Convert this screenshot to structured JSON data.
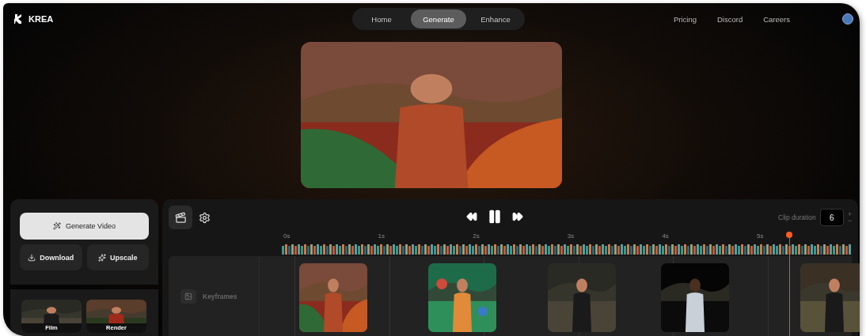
{
  "brand": "KREA",
  "nav_tabs": [
    {
      "label": "Home",
      "selected": false
    },
    {
      "label": "Generate",
      "selected": true
    },
    {
      "label": "Enhance",
      "selected": false
    }
  ],
  "links": [
    "Pricing",
    "Discord",
    "Careers"
  ],
  "actions": {
    "generate": "Generate Video",
    "download": "Download",
    "upscale": "Upscale"
  },
  "styles": [
    {
      "label": "Film"
    },
    {
      "label": "Render"
    }
  ],
  "timeline": {
    "clip_duration_label": "Clip duration",
    "clip_duration": "6",
    "increment": "+",
    "decrement": "−",
    "ticks": [
      "0s",
      "1s",
      "2s",
      "3s",
      "4s",
      "5s"
    ],
    "playhead": {
      "level": 0.89
    },
    "track_label": "Keyframes"
  }
}
